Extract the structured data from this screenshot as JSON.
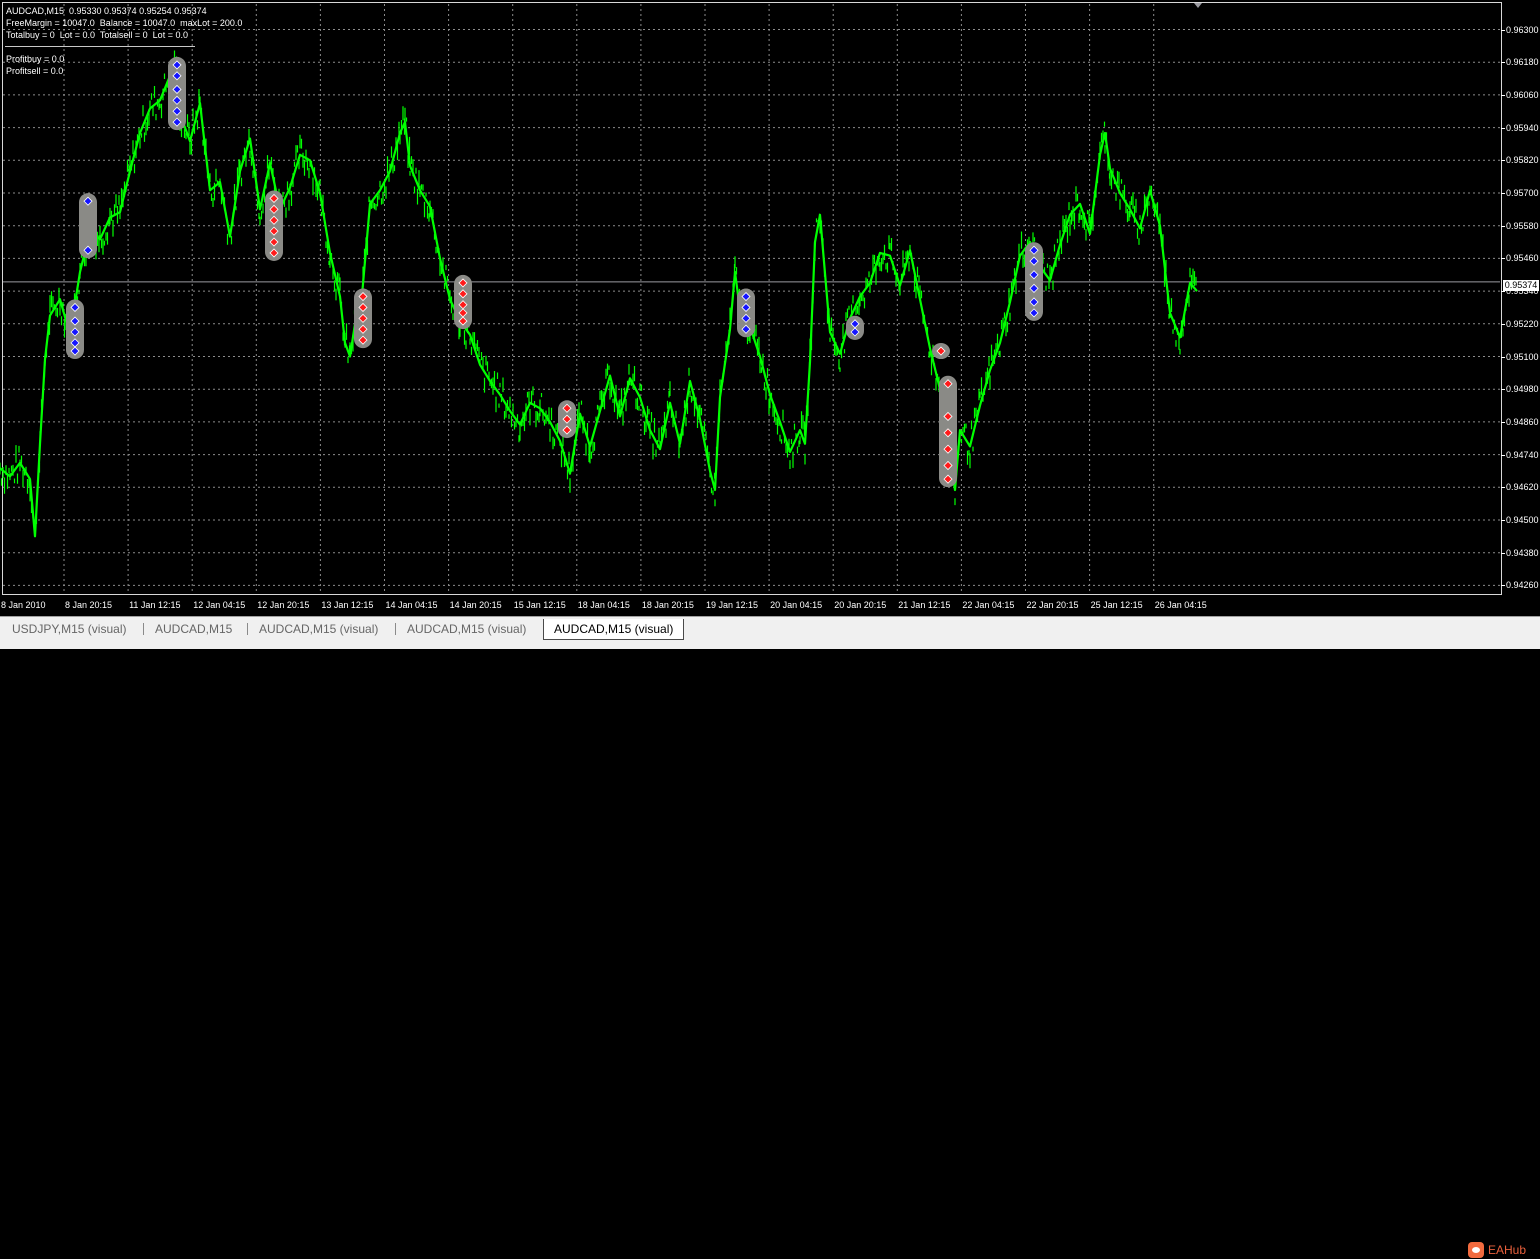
{
  "chart": {
    "symbol_line": "AUDCAD,M15  0.95330 0.95374 0.95254 0.95374",
    "free_margin_line": "FreeMargin = 10047.0  Balance = 10047.0  maxLot = 200.0",
    "totals_line": "Totalbuy = 0  Lot = 0.0  Totalsell = 0  Lot = 0.0",
    "profit_buy_line": "Profitbuy = 0.0",
    "profit_sell_line": "Profitsell = 0.0",
    "current_price": "0.95374",
    "colors": {
      "background": "#000000",
      "grid": "#8c8c8c",
      "price_line": "#00ff00",
      "buy_marker": "#1414ff",
      "sell_marker": "#ff1a1a",
      "marker_halo": "#8a8a86"
    }
  },
  "chart_data": {
    "type": "line",
    "y_ticks": [
      "0.96300",
      "0.96180",
      "0.96060",
      "0.95940",
      "0.95820",
      "0.95700",
      "0.95580",
      "0.95460",
      "0.95340",
      "0.95220",
      "0.95100",
      "0.94980",
      "0.94860",
      "0.94740",
      "0.94620",
      "0.94500",
      "0.94380",
      "0.94260"
    ],
    "x_ticks": [
      "8 Jan 2010",
      "8 Jan 20:15",
      "11 Jan 12:15",
      "12 Jan 04:15",
      "12 Jan 20:15",
      "13 Jan 12:15",
      "14 Jan 04:15",
      "14 Jan 20:15",
      "15 Jan 12:15",
      "18 Jan 04:15",
      "18 Jan 20:15",
      "19 Jan 12:15",
      "20 Jan 04:15",
      "20 Jan 20:15",
      "21 Jan 12:15",
      "22 Jan 04:15",
      "22 Jan 20:15",
      "25 Jan 12:15",
      "26 Jan 04:15"
    ],
    "ylim": [
      0.9426,
      0.9636
    ],
    "grid": true,
    "series": [
      {
        "x": [
          0,
          10,
          20,
          30,
          35,
          40,
          45,
          50,
          60,
          70,
          80,
          90,
          100,
          110,
          120,
          130,
          140,
          150,
          160,
          170,
          175,
          180,
          190,
          200,
          210,
          220,
          230,
          240,
          250,
          260,
          270,
          280,
          290,
          300,
          310,
          320,
          330,
          340,
          345,
          350,
          355,
          360,
          370,
          380,
          390,
          400,
          405,
          410,
          420,
          430,
          440,
          450,
          460,
          470,
          480,
          490,
          500,
          510,
          520,
          530,
          540,
          550,
          560,
          570,
          580,
          590,
          600,
          610,
          620,
          630,
          640,
          650,
          660,
          670,
          680,
          690,
          700,
          710,
          715,
          720,
          730,
          735,
          740,
          750,
          760,
          770,
          780,
          790,
          800,
          805,
          810,
          815,
          820,
          830,
          840,
          850,
          860,
          870,
          880,
          890,
          900,
          910,
          920,
          930,
          940,
          945,
          950,
          955,
          960,
          970,
          980,
          990,
          1000,
          1010,
          1020,
          1030,
          1040,
          1050,
          1060,
          1070,
          1080,
          1090,
          1100,
          1105,
          1110,
          1120,
          1130,
          1140,
          1150,
          1160,
          1170,
          1180,
          1190,
          1197
        ],
        "values": [
          0.9469,
          0.9466,
          0.9471,
          0.9465,
          0.9444,
          0.9478,
          0.9509,
          0.9525,
          0.9531,
          0.9518,
          0.9541,
          0.9556,
          0.9553,
          0.9561,
          0.9563,
          0.9578,
          0.9592,
          0.9601,
          0.9604,
          0.9613,
          0.9618,
          0.9599,
          0.9589,
          0.9603,
          0.9571,
          0.9574,
          0.9554,
          0.9578,
          0.959,
          0.9564,
          0.9581,
          0.9564,
          0.9572,
          0.9584,
          0.9582,
          0.957,
          0.9548,
          0.9532,
          0.9515,
          0.951,
          0.9522,
          0.9524,
          0.9566,
          0.9571,
          0.9578,
          0.9592,
          0.9596,
          0.958,
          0.9571,
          0.9565,
          0.9546,
          0.9531,
          0.9523,
          0.9518,
          0.9507,
          0.9501,
          0.9496,
          0.949,
          0.9485,
          0.9493,
          0.9491,
          0.9486,
          0.9479,
          0.9467,
          0.9489,
          0.9477,
          0.949,
          0.9503,
          0.9488,
          0.9502,
          0.9495,
          0.9483,
          0.9476,
          0.9493,
          0.9478,
          0.9501,
          0.9487,
          0.9468,
          0.9461,
          0.9495,
          0.952,
          0.9541,
          0.9527,
          0.9521,
          0.951,
          0.9496,
          0.9486,
          0.9475,
          0.9483,
          0.9478,
          0.9508,
          0.9552,
          0.9562,
          0.9519,
          0.9511,
          0.9524,
          0.9532,
          0.9537,
          0.9548,
          0.9547,
          0.9536,
          0.9549,
          0.9531,
          0.9513,
          0.9498,
          0.9488,
          0.9473,
          0.9461,
          0.9483,
          0.9477,
          0.9492,
          0.9505,
          0.9515,
          0.953,
          0.9547,
          0.9552,
          0.9543,
          0.9538,
          0.9551,
          0.9562,
          0.9566,
          0.9555,
          0.9584,
          0.9592,
          0.9579,
          0.957,
          0.9564,
          0.9557,
          0.9571,
          0.9558,
          0.9526,
          0.9517,
          0.9537,
          0.9534
        ]
      }
    ],
    "markers": [
      {
        "type": "buy",
        "x": 75,
        "values": [
          0.9528,
          0.9523,
          0.9519,
          0.9515,
          0.9512
        ]
      },
      {
        "type": "buy",
        "x": 88,
        "values": [
          0.9567,
          0.9549
        ]
      },
      {
        "type": "buy",
        "x": 177,
        "values": [
          0.9617,
          0.9613,
          0.9608,
          0.9604,
          0.96,
          0.9596
        ]
      },
      {
        "type": "sell",
        "x": 274,
        "values": [
          0.9568,
          0.9564,
          0.956,
          0.9556,
          0.9552,
          0.9548
        ]
      },
      {
        "type": "sell",
        "x": 363,
        "values": [
          0.9532,
          0.9528,
          0.9524,
          0.952,
          0.9516
        ]
      },
      {
        "type": "sell",
        "x": 463,
        "values": [
          0.9537,
          0.9533,
          0.9529,
          0.9526,
          0.9523
        ]
      },
      {
        "type": "sell",
        "x": 567,
        "values": [
          0.9491,
          0.9487,
          0.9483
        ]
      },
      {
        "type": "buy",
        "x": 746,
        "values": [
          0.9532,
          0.9528,
          0.9524,
          0.952
        ]
      },
      {
        "type": "buy",
        "x": 855,
        "values": [
          0.9522,
          0.9519
        ]
      },
      {
        "type": "sell",
        "x": 941,
        "values": [
          0.9512
        ]
      },
      {
        "type": "sell",
        "x": 948,
        "values": [
          0.95,
          0.9488,
          0.9482,
          0.9476,
          0.947,
          0.9465
        ]
      },
      {
        "type": "buy",
        "x": 1034,
        "values": [
          0.9549,
          0.9545,
          0.954,
          0.9535,
          0.953,
          0.9526
        ]
      }
    ]
  },
  "tabs": [
    {
      "label": "USDJPY,M15 (visual)",
      "active": false
    },
    {
      "label": "AUDCAD,M15",
      "active": false
    },
    {
      "label": "AUDCAD,M15 (visual)",
      "active": false
    },
    {
      "label": "AUDCAD,M15 (visual)",
      "active": false
    },
    {
      "label": "AUDCAD,M15 (visual)",
      "active": true
    }
  ],
  "brand": {
    "text": "EAHub",
    "icon": "eahub-logo-icon"
  }
}
